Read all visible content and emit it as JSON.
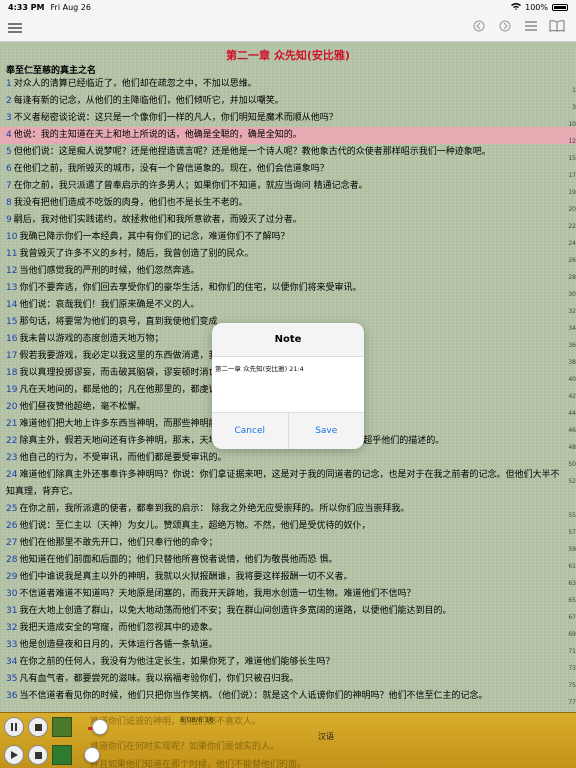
{
  "status": {
    "time": "4:33 PM",
    "date": "Fri Aug 26",
    "battery": "100%"
  },
  "toolbar": {
    "left_icon": "menu-icon",
    "right_icons": [
      "back-icon",
      "forward-icon",
      "list-icon",
      "book-icon"
    ]
  },
  "reader": {
    "chapter_title": "第二一章 众先知(安比雅)",
    "section_title": "奉至仁至慈的真主之名",
    "verses": [
      {
        "n": "1",
        "text": "对众人的清算已经临近了，他们却在疏忽之中，不加以思维。",
        "side": "1"
      },
      {
        "n": "2",
        "text": "每逢有新的记念，从他们的主降临他们，他们倾听它，并加以嘲笑。",
        "side": "3"
      },
      {
        "n": "3",
        "text": "不义者秘密谈论说：这只是一个像你们一样的凡人，你们明知是魔术而顺从他吗？",
        "side": "10"
      },
      {
        "n": "4",
        "text": "他说：我的主知道在天上和地上所说的话，他确是全聪的，确是全知的。",
        "side": "12"
      },
      {
        "n": "5",
        "text": "但他们说：这是痴人说梦呢？还是他捏造谎言呢？还是他是一个诗人呢？教他象古代的众使者那样昭示我们一种迹象吧。",
        "side": "15"
      },
      {
        "n": "6",
        "text": "在他们之前，我所毁灭的城市，没有一个曾信道象的。现在，他们会信道象吗？",
        "side": "17"
      },
      {
        "n": "7",
        "text": "在你之前，我只派遣了曾奉启示的许多男人；如果你们不知道，就应当询问 精通记念者。",
        "side": "19"
      },
      {
        "n": "8",
        "text": "我没有把他们造成不吃饭的肉身，他们也不是长生不老的。",
        "side": "20"
      },
      {
        "n": "9",
        "text": "嗣后，我对他们实践诺约，故拯救他们和我所意欲者，而毁灭了过分者。",
        "side": "22"
      },
      {
        "n": "10",
        "text": "我确已降示你们一本经典，其中有你们的记念，难道你们不了解吗？",
        "side": "24"
      },
      {
        "n": "11",
        "text": "我曾毁灭了许多不义的乡村，随后，我曾创造了别的民众。",
        "side": "26"
      },
      {
        "n": "12",
        "text": "当他们感觉我的严刑的时候，他们忽然奔逃。",
        "side": "28"
      },
      {
        "n": "13",
        "text": "你们不要奔逃，你们回去享受你们的豪华生活，和你们的住宅，以便你们将来受审讯。",
        "side": "30"
      },
      {
        "n": "14",
        "text": "他们说：哀哉我们！我们原来确是不义的人。",
        "side": "32"
      },
      {
        "n": "15",
        "text": "那句话，将要常为他们的哀号，直到我使他们变成",
        "side": "34"
      },
      {
        "n": "16",
        "text": "我未曾以游戏的态度创造天地万物；",
        "side": "36"
      },
      {
        "n": "17",
        "text": "假若我要游戏，我必定以我这里的东西做消遣，我",
        "side": "38"
      },
      {
        "n": "18",
        "text": "我以真理投掷谬妄，而击破其脑袋，谬妄顿时消亡",
        "side": "40"
      },
      {
        "n": "19",
        "text": "凡在天地间的，都是他的；凡在他那里的，都虔诚",
        "side": "42"
      },
      {
        "n": "20",
        "text": "他们昼夜赞他超绝，毫不松懈。",
        "side": "44"
      },
      {
        "n": "21",
        "text": "难道他们把大地上许多东西当神明，而那些神明能",
        "side": "46"
      },
      {
        "n": "22",
        "text": "除真主外，假若天地间还有许多神明，那末，天地必定破坏了。赞颂真主─宝座的主─是超乎他们的描述的。",
        "side": "48"
      },
      {
        "n": "23",
        "text": "他自己的行为，不受审讯，而他们都是要受审讯的。",
        "side": "50"
      },
      {
        "n": "24",
        "text": "难道他们除真主外还事奉许多神明吗？你说：你们拿证据来吧，这是对于我的同道者的记念，也是对于在我之前者的记念。但他们大半不知真理，背弃它。",
        "side": "52"
      },
      {
        "n": "25",
        "text": "在你之前，我所派遣的使者，都奉到我的启示： 除我之外绝无应受崇拜的。所以你们应当崇拜我。",
        "side": "55"
      },
      {
        "n": "26",
        "text": "他们说：至仁主以（天神）为女儿。赞颂真主，超绝万物。不然，他们是受优待的奴仆，",
        "side": "57"
      },
      {
        "n": "27",
        "text": "他们在他那里不敢先开口，他们只奉行他的命令；",
        "side": "59"
      },
      {
        "n": "28",
        "text": "他知道在他们前面和后面的；他们只替他所喜悦者说情，他们为敬畏他而恐 惧。",
        "side": "61"
      },
      {
        "n": "29",
        "text": "他们中谁说我是真主以外的神明，我就以火狱报酬谁，我将要这样报酬一切不义者。",
        "side": "63"
      },
      {
        "n": "30",
        "text": "不信道者难道不知道吗？天地原是闭塞的，而我开天辟地，我用水创造一切生物。难道他们不信吗？",
        "side": "65"
      },
      {
        "n": "31",
        "text": "我在大地上创造了群山，以免大地动荡而他们不安；我在群山间创造许多宽阔的道路，以便他们能达到目的。",
        "side": "67"
      },
      {
        "n": "32",
        "text": "我把天造成安全的穹窿，而他们忽视其中的迹象。",
        "side": "69"
      },
      {
        "n": "33",
        "text": "他是创造昼夜和日月的，天体运行各循一条轨道。",
        "side": "71"
      },
      {
        "n": "34",
        "text": "在你之前的任何人，我没有为他注定长生，如果你死了，难道他们能够长生吗？",
        "side": "73"
      },
      {
        "n": "35",
        "text": "凡有血气者，都要尝死的滋味。我以祸福考验你们，你们只被召归我。",
        "side": "75"
      },
      {
        "n": "36",
        "text": "当不信道者看见你的时候，他们只把你当作笑柄。（他们说）：就是这个人诋谤你们的神明吗？他们不信至仁主的记念。",
        "side": "77"
      }
    ]
  },
  "dialog": {
    "title": "Note",
    "text": "第二一章 众先知(安比雅) 21:4",
    "cancel_label": "Cancel",
    "save_label": "Save"
  },
  "player": {
    "lang_label": "汉语",
    "progress_label": "6:08/8:16",
    "ghost_line1": "难道你们诋毁的神明，那他们都不喜欢人。",
    "ghost_line2": "难道你们在何时实现呢？如果你们是诚实的人。",
    "ghost_line3": "并且如果他们知道在那个时候，他们不能替他们的面。"
  },
  "colors": {
    "title_red": "#d0112b",
    "verse_blue": "#1a3fae",
    "highlight": "#e7a9b2",
    "accent_blue": "#1a73e8",
    "player_gold": "#d9ad2c"
  }
}
